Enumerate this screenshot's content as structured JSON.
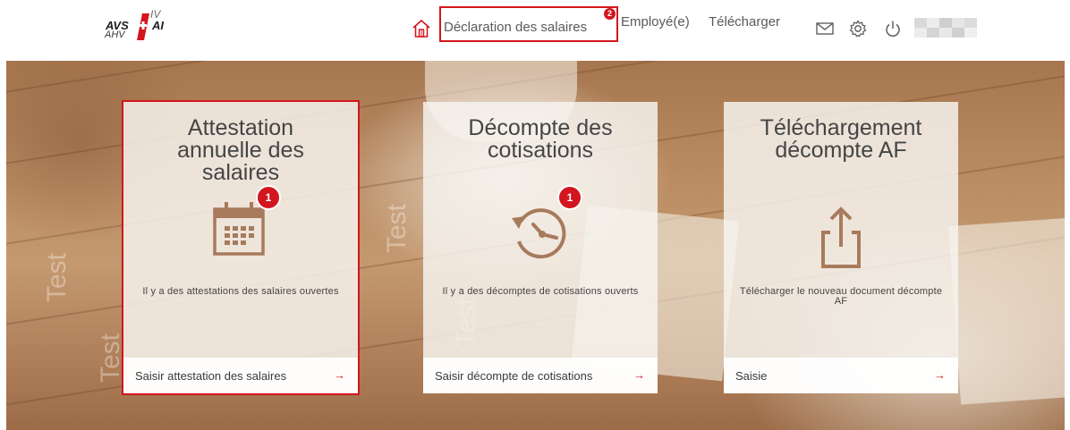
{
  "logo": {
    "avs": "AVS",
    "ahv": "AHV",
    "iv": "IV",
    "ai": "AI"
  },
  "nav": {
    "home_icon": "home-icon",
    "active_label": "Déclaration des salaires",
    "badge": "2",
    "employee_label": "Employé(e)",
    "download_label": "Télécharger",
    "icons": [
      "envelope-icon",
      "gear-icon",
      "power-icon"
    ]
  },
  "cards": [
    {
      "title_lines": [
        "Attestation",
        "annuelle des",
        "salaires"
      ],
      "icon": "calendar-icon",
      "badge": "1",
      "description": "Il y a des attestations des salaires ouvertes",
      "action": "Saisir attestation des salaires",
      "arrow": "→"
    },
    {
      "title_lines": [
        "Décompte des",
        "cotisations"
      ],
      "icon": "history-clock-icon",
      "badge": "1",
      "description": "Il y a des décomptes de cotisations ouverts",
      "action": "Saisir décompte de cotisations",
      "arrow": "→"
    },
    {
      "title_lines": [
        "Téléchargement",
        "décompte AF"
      ],
      "icon": "upload-share-icon",
      "description": "Télécharger le nouveau document décompte AF",
      "action": "Saisie",
      "arrow": "→"
    }
  ],
  "watermark": "Test",
  "colors": {
    "accent": "#d2161e",
    "icon_brown": "#a87a5c",
    "text": "#454545"
  }
}
